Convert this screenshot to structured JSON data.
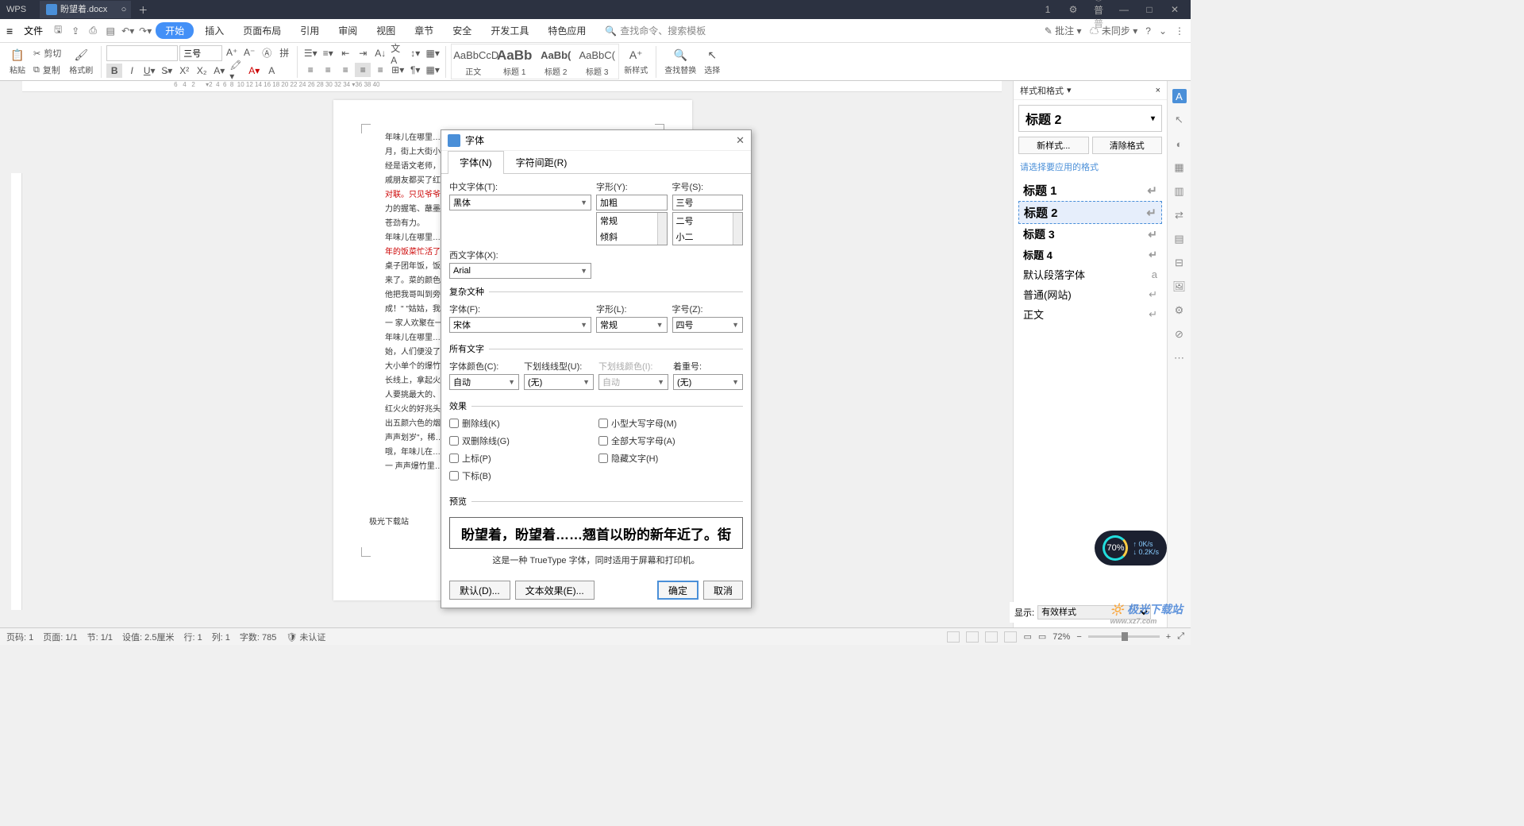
{
  "titlebar": {
    "logo": "WPS",
    "tab_name": "盼望着.docx",
    "user": "普普"
  },
  "menubar": {
    "file": "文件",
    "items": [
      "开始",
      "插入",
      "页面布局",
      "引用",
      "审阅",
      "视图",
      "章节",
      "安全",
      "开发工具",
      "特色应用"
    ],
    "search_placeholder": "查找命令、搜索模板",
    "remark": "批注",
    "sync": "未同步"
  },
  "ribbon": {
    "paste": "粘贴",
    "cut": "剪切",
    "copy": "复制",
    "format_painter": "格式刷",
    "font_name": "",
    "font_size": "三号",
    "styles": [
      {
        "preview": "AaBbCcD",
        "name": "正文"
      },
      {
        "preview": "AaBb",
        "name": "标题 1"
      },
      {
        "preview": "AaBb(",
        "name": "标题 2"
      },
      {
        "preview": "AaBbC(",
        "name": "标题 3"
      }
    ],
    "new_style": "新样式",
    "find_replace": "查找替换",
    "select": "选择"
  },
  "document": {
    "paragraphs": [
      "年味儿在哪里……",
      "月，街上大街小巷……",
      "经是语文老师，写……",
      "戚朋友都买了红纸……",
      "对联。只见爷爷……",
      "力的握笔、蘸墨……",
      "苍劲有力。",
      "年味儿在哪里……",
      "年的饭菜忙活了……",
      "桌子团年饭，饭桌……",
      "来了。菜的颜色也……",
      "他把我哥叫到旁……",
      "成！\" \"姑姑，我……",
      "一 家人欢聚在一……",
      "年味儿在哪里……",
      "始，人们便没了睡……",
      "大小单个的爆竹串……",
      "长线上，拿起火把……",
      "人要挑最大的、最……",
      "红火火的好兆头。……",
      "出五颜六色的烟花……",
      "声声划岁\"，稀……",
      "哦，年味儿在……",
      "一 声声爆竹里……"
    ],
    "footer": "极光下载站"
  },
  "dialog": {
    "title": "字体",
    "tabs": [
      "字体(N)",
      "字符间距(R)"
    ],
    "labels": {
      "cn_font": "中文字体(T):",
      "west_font": "西文字体(X):",
      "style": "字形(Y):",
      "size": "字号(S):",
      "complex_heading": "复杂文种",
      "font_f": "字体(F):",
      "style_l": "字形(L):",
      "size_z": "字号(Z):",
      "all_text": "所有文字",
      "font_color": "字体颜色(C):",
      "underline": "下划线线型(U):",
      "underline_color": "下划线颜色(I):",
      "emphasis": "着重号:",
      "effects": "效果",
      "preview": "预览"
    },
    "values": {
      "cn_font": "黑体",
      "west_font": "Arial",
      "style": "加粗",
      "size": "三号",
      "font_f": "宋体",
      "style_l": "常规",
      "size_z": "四号",
      "font_color": "自动",
      "underline": "(无)",
      "underline_color": "自动",
      "emphasis": "(无)"
    },
    "style_options": [
      "常规",
      "倾斜",
      "加粗"
    ],
    "size_options": [
      "二号",
      "小二",
      "三号"
    ],
    "checkboxes": {
      "strike": "删除线(K)",
      "dstrike": "双删除线(G)",
      "sup": "上标(P)",
      "sub": "下标(B)",
      "smallcaps": "小型大写字母(M)",
      "allcaps": "全部大写字母(A)",
      "hidden": "隐藏文字(H)"
    },
    "preview_text": "盼望着，盼望着……翘首以盼的新年近了。街",
    "truetype_hint": "这是一种 TrueType 字体，同时适用于屏幕和打印机。",
    "buttons": {
      "default": "默认(D)...",
      "text_effect": "文本效果(E)...",
      "ok": "确定",
      "cancel": "取消"
    }
  },
  "styles_panel": {
    "title": "样式和格式",
    "current": "标题 2",
    "new_style": "新样式...",
    "clear": "清除格式",
    "select_hint": "请选择要应用的格式",
    "items": [
      "标题 1",
      "标题 2",
      "标题 3",
      "标题 4",
      "默认段落字体",
      "普通(网站)",
      "正文"
    ],
    "show_label": "显示:",
    "show_value": "有效样式"
  },
  "statusbar": {
    "page": "页码: 1",
    "page_of": "页面: 1/1",
    "section": "节: 1/1",
    "pos": "设值: 2.5厘米",
    "line": "行: 1",
    "col": "列: 1",
    "words": "字数: 785",
    "auth": "未认证",
    "zoom": "72%"
  },
  "speed": {
    "pct": "70%",
    "up": "0K/s",
    "down": "0.2K/s"
  },
  "watermark": "极光下载站"
}
